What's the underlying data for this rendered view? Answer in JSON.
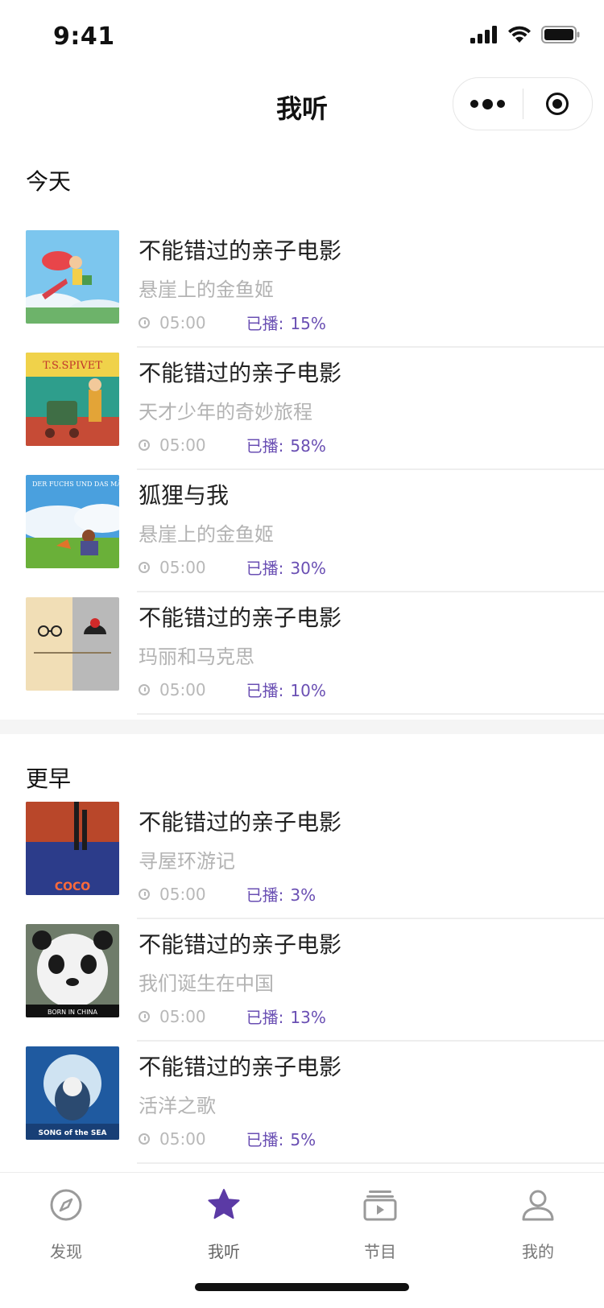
{
  "status": {
    "time": "9:41"
  },
  "nav": {
    "title": "我听"
  },
  "sections": {
    "today": "今天",
    "earlier": "更早"
  },
  "played_prefix": "已播:",
  "items": [
    {
      "title": "不能错过的亲子电影",
      "subtitle": "悬崖上的金鱼姬",
      "duration": "05:00",
      "played": "15%"
    },
    {
      "title": "不能错过的亲子电影",
      "subtitle": "天才少年的奇妙旅程",
      "duration": "05:00",
      "played": "58%"
    },
    {
      "title": "狐狸与我",
      "subtitle": "悬崖上的金鱼姬",
      "duration": "05:00",
      "played": "30%"
    },
    {
      "title": "不能错过的亲子电影",
      "subtitle": "玛丽和马克思",
      "duration": "05:00",
      "played": "10%"
    },
    {
      "title": "不能错过的亲子电影",
      "subtitle": "寻屋环游记",
      "duration": "05:00",
      "played": "3%"
    },
    {
      "title": "不能错过的亲子电影",
      "subtitle": "我们诞生在中国",
      "duration": "05:00",
      "played": "13%"
    },
    {
      "title": "不能错过的亲子电影",
      "subtitle": "活洋之歌",
      "duration": "05:00",
      "played": "5%"
    }
  ],
  "poster_text": {
    "spivet": "T.S.SPIVET",
    "fuchs": "DER FUCHS UND DAS MÄDCHEN",
    "coco": "COCO",
    "born": "BORN IN CHINA",
    "song": "SONG of the SEA"
  },
  "tabs": [
    {
      "label": "发现",
      "icon": "compass-icon",
      "active": false
    },
    {
      "label": "我听",
      "icon": "star-icon",
      "active": true
    },
    {
      "label": "节目",
      "icon": "playlist-icon",
      "active": false
    },
    {
      "label": "我的",
      "icon": "user-icon",
      "active": false
    }
  ],
  "colors": {
    "accent": "#5b3aa5",
    "played_text": "#6a4fb3",
    "muted": "#b3b3b3"
  }
}
